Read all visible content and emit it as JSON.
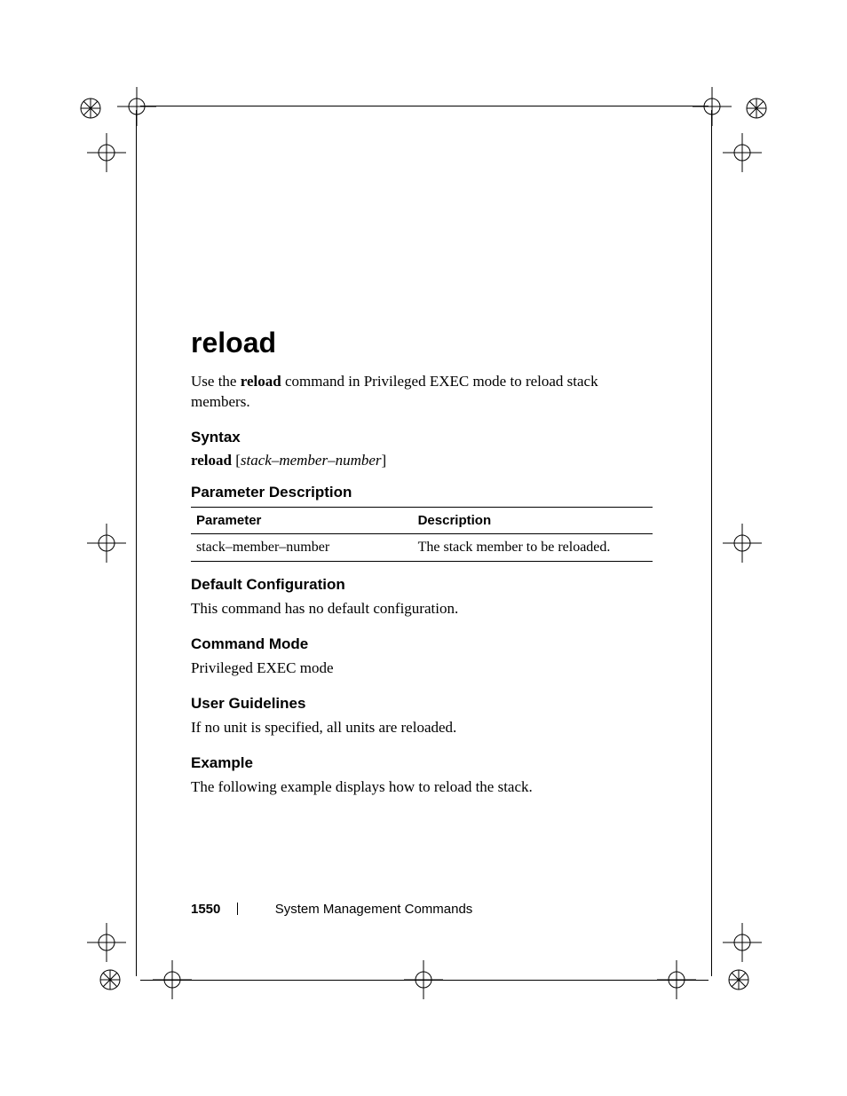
{
  "command": {
    "title": "reload",
    "intro_prefix": "Use the ",
    "intro_cmd": "reload",
    "intro_suffix": " command in Privileged EXEC mode to reload stack members."
  },
  "syntax": {
    "heading": "Syntax",
    "cmd": "reload",
    "open": " [",
    "arg": "stack–member–number",
    "close": "]"
  },
  "param_desc": {
    "heading": "Parameter Description",
    "col1": "Parameter",
    "col2": "Description",
    "rows": [
      {
        "p": "stack–member–number",
        "d": "The stack member to be reloaded."
      }
    ]
  },
  "default_cfg": {
    "heading": "Default Configuration",
    "text": "This command has no default configuration."
  },
  "cmd_mode": {
    "heading": "Command Mode",
    "text": "Privileged EXEC mode"
  },
  "guidelines": {
    "heading": "User Guidelines",
    "text": " If no unit is specified, all units are reloaded."
  },
  "example": {
    "heading": "Example",
    "text": "The following example displays how to reload the stack."
  },
  "footer": {
    "page": "1550",
    "chapter": "System Management Commands"
  }
}
